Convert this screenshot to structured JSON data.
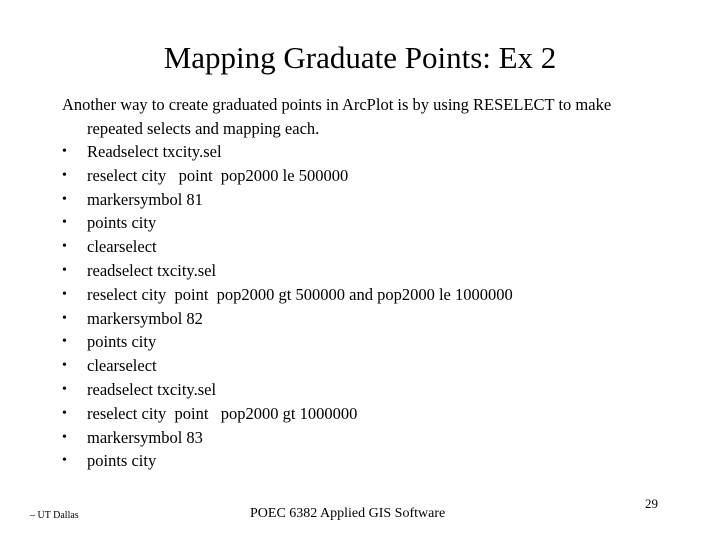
{
  "slide": {
    "title": "Mapping Graduate Points: Ex 2",
    "intro_line1": "Another way to create graduated points in ArcPlot is by  using RESELECT to make",
    "intro_line2": "repeated selects and mapping each.",
    "bullet_glyph": "•",
    "bullets": [
      "Readselect txcity.sel",
      "reselect city   point  pop2000 le 500000",
      "markersymbol 81",
      "points city",
      "clearselect",
      "readselect txcity.sel",
      "reselect city  point  pop2000 gt 500000 and pop2000 le 1000000",
      "markersymbol 82",
      "points city",
      "clearselect",
      "readselect txcity.sel",
      "reselect city  point   pop2000 gt 1000000",
      "markersymbol 83",
      "points city"
    ]
  },
  "footer": {
    "left": "– UT Dallas",
    "center": "POEC 6382 Applied GIS Software",
    "page_number": "29"
  }
}
